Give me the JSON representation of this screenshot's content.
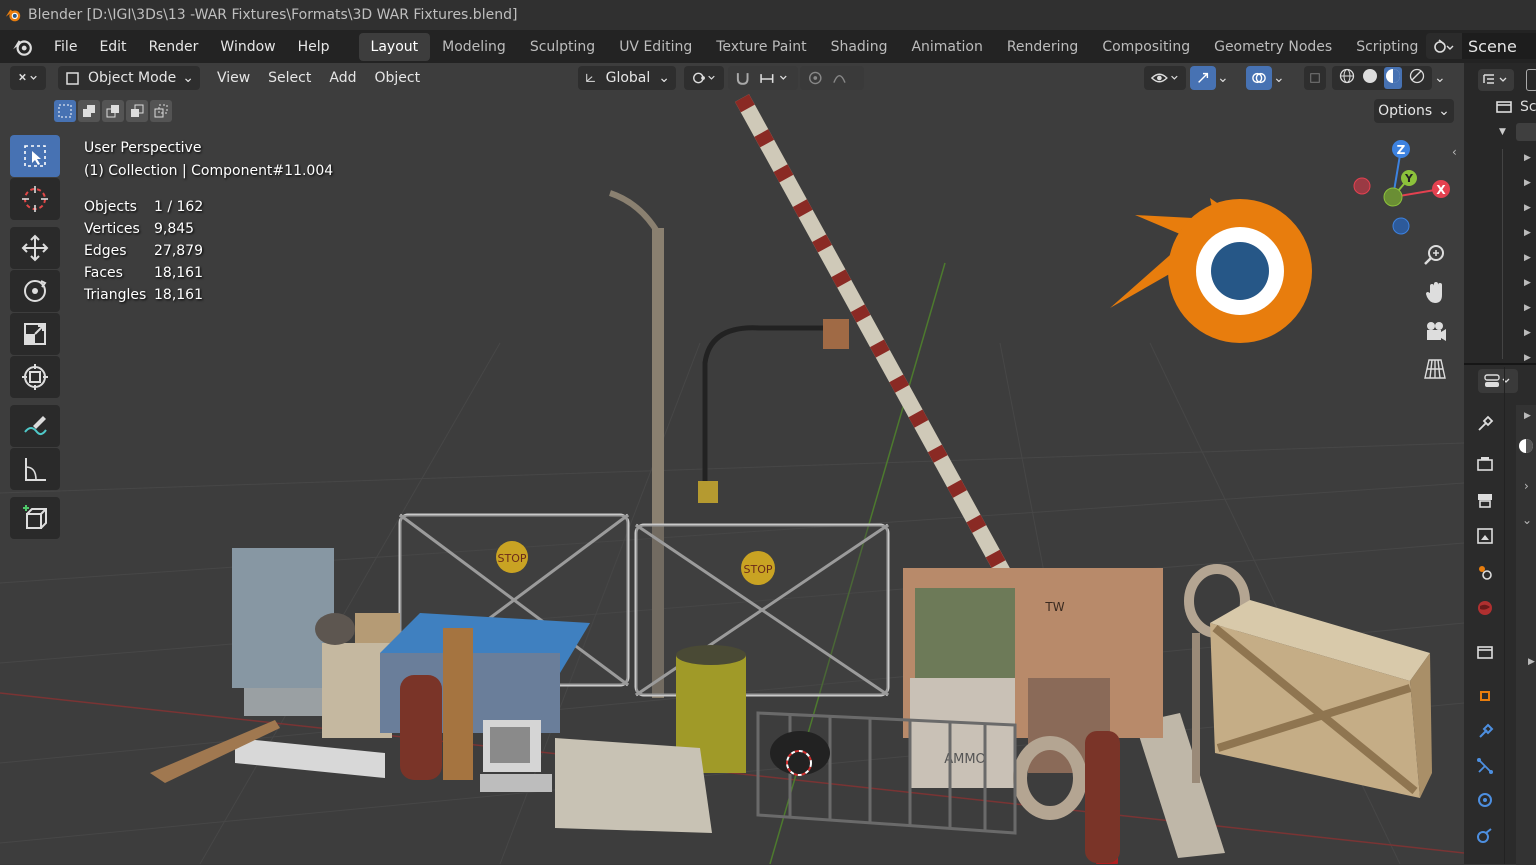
{
  "window": {
    "title": "Blender [D:\\IGI\\3Ds\\13 -WAR Fixtures\\Formats\\3D WAR Fixtures.blend]"
  },
  "menubar": {
    "items": [
      "File",
      "Edit",
      "Render",
      "Window",
      "Help"
    ]
  },
  "workspaces": {
    "tabs": [
      "Layout",
      "Modeling",
      "Sculpting",
      "UV Editing",
      "Texture Paint",
      "Shading",
      "Animation",
      "Rendering",
      "Compositing",
      "Geometry Nodes",
      "Scripting"
    ],
    "active": "Layout",
    "add": "+"
  },
  "scene": {
    "name": "Scene"
  },
  "viewport_header": {
    "mode": "Object Mode",
    "menus": [
      "View",
      "Select",
      "Add",
      "Object"
    ],
    "orientation": "Global",
    "options": "Options"
  },
  "overlay": {
    "perspective": "User Perspective",
    "collection": "(1) Collection | Component#11.004"
  },
  "stats": [
    {
      "label": "Objects",
      "value": "1 / 162"
    },
    {
      "label": "Vertices",
      "value": "9,845"
    },
    {
      "label": "Edges",
      "value": "27,879"
    },
    {
      "label": "Faces",
      "value": "18,161"
    },
    {
      "label": "Triangles",
      "value": "18,161"
    }
  ],
  "gizmo": {
    "x": "X",
    "y": "Y",
    "z": "Z"
  },
  "outliner": {
    "label": "Sc"
  },
  "fixtures": {
    "stop_sign_1": "STOP",
    "stop_sign_2": "STOP",
    "crate_text": "TW",
    "ammo_text": "AMMO"
  },
  "colors": {
    "accent": "#4772b3",
    "blender_orange": "#e87d0d",
    "blender_blue": "#265787",
    "axis_x": "#e44150",
    "axis_y": "#8cc23b",
    "axis_z": "#3d82e0"
  }
}
